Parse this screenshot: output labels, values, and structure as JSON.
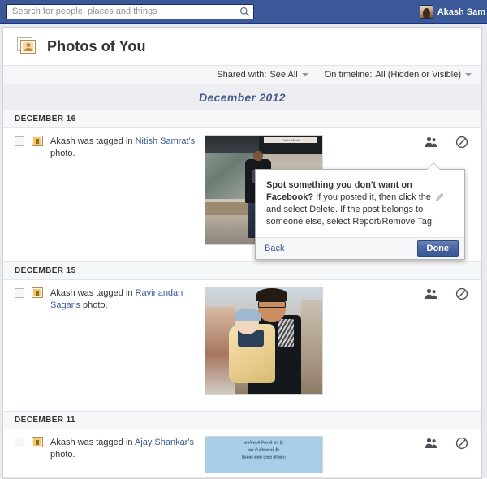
{
  "topbar": {
    "search_placeholder": "Search for people, places and things",
    "search_value": "",
    "search_icon": "search-icon",
    "user_name": "Akash Sam",
    "background_color": "#3b5998"
  },
  "header": {
    "page_title": "Photos of You",
    "title_icon": "photos-of-you-icon"
  },
  "filters": [
    {
      "label": "Shared with:",
      "value": "See All",
      "caret": "chevron-down-icon"
    },
    {
      "label": "On timeline:",
      "value": "All (Hidden or Visible)",
      "caret": "chevron-down-icon"
    }
  ],
  "month": {
    "label": "December 2012",
    "color": "#4a5a8c"
  },
  "sections": [
    {
      "date_label": "DECEMBER 16",
      "story": {
        "prefix": "Akash was tagged in ",
        "link": "Nitish Samrat's",
        "suffix": " photo."
      },
      "photo": {
        "kind": "man-standing-in-mall",
        "sign_text": "FABINDIA"
      },
      "actions": [
        {
          "icon": "tagged-friends-icon"
        },
        {
          "icon": "hidden-from-timeline-icon"
        }
      ]
    },
    {
      "date_label": "DECEMBER 15",
      "story": {
        "prefix": "Akash was tagged in ",
        "link": "Ravinandan Sagar's",
        "suffix": " photo."
      },
      "photo": {
        "kind": "man-holding-baby",
        "sign_text": ""
      },
      "actions": [
        {
          "icon": "tagged-friends-icon"
        },
        {
          "icon": "hidden-from-timeline-icon"
        }
      ]
    },
    {
      "date_label": "DECEMBER 11",
      "story": {
        "prefix": "Akash was tagged in ",
        "link": "Ajay Shankar's",
        "suffix": " photo."
      },
      "photo": {
        "kind": "hindi-text-card",
        "lines": [
          "अपने सपने निडर से सच है।",
          "बस वो सोचना पड़े है।",
          "किसको सबसे ज़्यादा की बात।"
        ]
      },
      "actions": [
        {
          "icon": "tagged-friends-icon"
        },
        {
          "icon": "hidden-from-timeline-icon"
        }
      ]
    }
  ],
  "tooltip": {
    "headline": "Spot something you don't want on Facebook?",
    "body_part1": " If you posted it, then click the ",
    "pencil_icon": "pencil-icon",
    "body_part2": " and select Delete. If the post belongs to someone else, select Report/Remove Tag.",
    "back_label": "Back",
    "done_label": "Done",
    "done_color": "#3b5998"
  }
}
